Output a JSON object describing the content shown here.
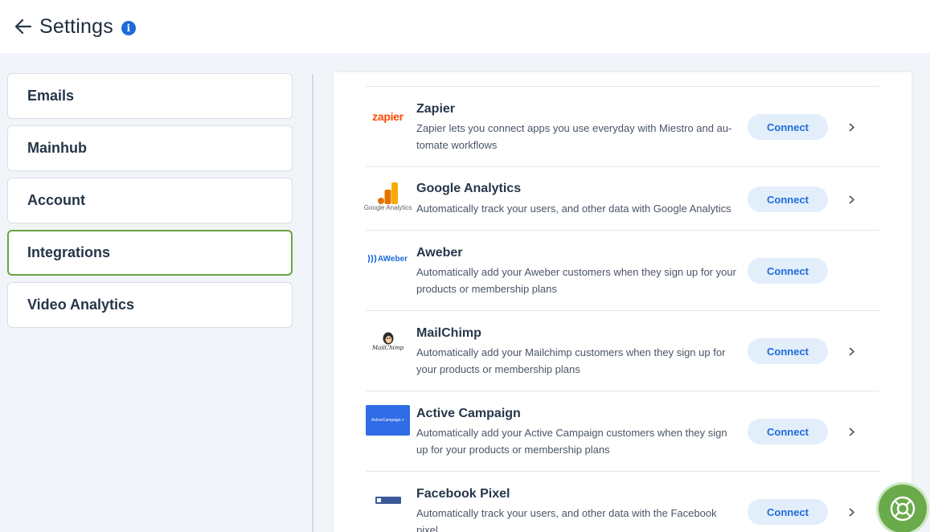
{
  "header": {
    "title": "Settings",
    "back_icon": "arrow-left-icon",
    "info_icon": "info-icon",
    "info_glyph": "i"
  },
  "sidebar": {
    "items": [
      {
        "label": "Emails",
        "active": false
      },
      {
        "label": "Mainhub",
        "active": false
      },
      {
        "label": "Account",
        "active": false
      },
      {
        "label": "Integrations",
        "active": true
      },
      {
        "label": "Video Analytics",
        "active": false
      }
    ]
  },
  "integrations": [
    {
      "name": "Zapier",
      "logo_text": "zapier",
      "description": "Zapier lets you connect apps you use everyday with Miestro and au-tomate workflows",
      "button": "Connect",
      "has_chevron": true
    },
    {
      "name": "Google Analytics",
      "logo_text": "Google Analytics",
      "description": "Automatically track your users, and other data with Google Analytics",
      "button": "Connect",
      "has_chevron": true
    },
    {
      "name": "Aweber",
      "logo_text": "AWeber",
      "description": "Automatically add your Aweber customers when they sign up for your products or membership plans",
      "button": "Connect",
      "has_chevron": false
    },
    {
      "name": "MailChimp",
      "logo_text": "MailChimp",
      "description": "Automatically add your Mailchimp customers when they sign up for your products or membership plans",
      "button": "Connect",
      "has_chevron": true
    },
    {
      "name": "Active Campaign",
      "logo_text": "ActiveCampaign >",
      "description": "Automatically add your Active Campaign customers when they sign up for your products or membership plans",
      "button": "Connect",
      "has_chevron": true
    },
    {
      "name": "Facebook Pixel",
      "logo_text": "",
      "description": "Automatically track your users, and other data with the Facebook pixel",
      "button": "Connect",
      "has_chevron": true
    }
  ],
  "colors": {
    "accent": "#1e6bd8",
    "active_border": "#6aa33f",
    "help_button": "#6aaa4b",
    "zapier": "#ff4a00",
    "active_campaign": "#2f6ce5"
  },
  "help_button": {
    "icon": "lifebuoy-icon"
  }
}
